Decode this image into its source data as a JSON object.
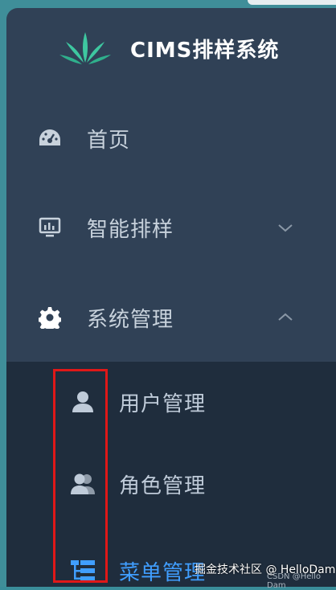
{
  "app": {
    "title": "CIMS排样系统",
    "logo_icon": "leaf-logo-icon"
  },
  "menu": [
    {
      "label": "首页",
      "icon": "dashboard-icon"
    },
    {
      "label": "智能排样",
      "icon": "monitor-icon",
      "chevron": "chevron-down-icon"
    },
    {
      "label": "系统管理",
      "icon": "gear-icon",
      "chevron": "chevron-up-icon",
      "expanded": true
    }
  ],
  "submenu": [
    {
      "label": "用户管理",
      "icon": "user-icon"
    },
    {
      "label": "角色管理",
      "icon": "users-icon"
    },
    {
      "label": "菜单管理",
      "icon": "tree-menu-icon",
      "active": true
    }
  ],
  "watermark": {
    "line1": "掘金技术社区 @ HelloDam",
    "line2": "CSDN @Hello Dam"
  },
  "colors": {
    "sidebar": "#304156",
    "submenu": "#1f2d3d",
    "active": "#409eff",
    "highlight": "#e01818"
  }
}
